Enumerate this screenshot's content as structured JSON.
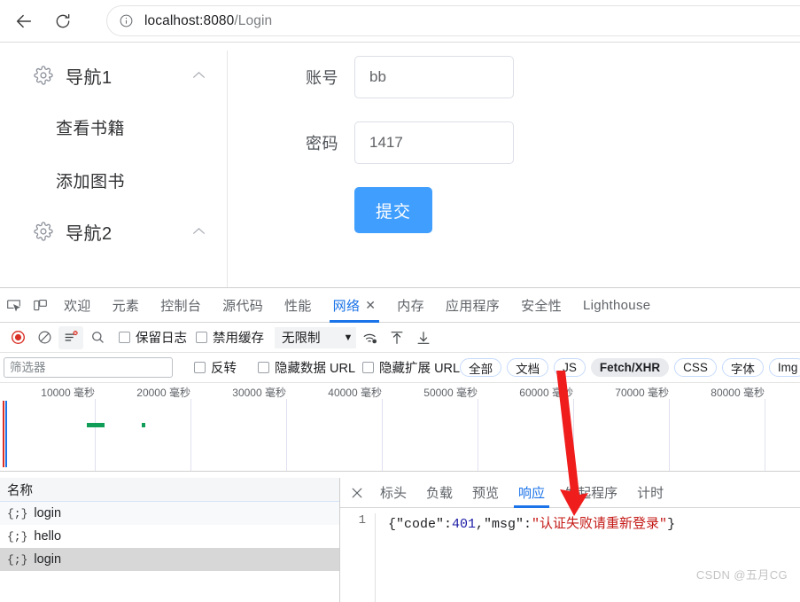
{
  "browser": {
    "back_label": "back-arrow",
    "reload_label": "reload",
    "site_info_label": "site-information",
    "url_host": "localhost:8080",
    "url_path": "/Login"
  },
  "page": {
    "sidebar": {
      "groups": [
        {
          "label": "导航1",
          "icon": "gear-icon",
          "expanded": true,
          "items": [
            "查看书籍",
            "添加图书"
          ]
        },
        {
          "label": "导航2",
          "icon": "gear-icon",
          "expanded": true,
          "items": []
        }
      ]
    },
    "form": {
      "fields": [
        {
          "label": "账号",
          "value": "bb",
          "placeholder": ""
        },
        {
          "label": "密码",
          "value": "1417",
          "placeholder": ""
        }
      ],
      "submit_label": "提交",
      "submit_color": "#409eff"
    }
  },
  "devtools": {
    "tools": [
      {
        "name": "inspect-element-icon"
      },
      {
        "name": "device-toolbar-icon"
      }
    ],
    "tabs": [
      {
        "label": "欢迎",
        "active": false,
        "closable": false
      },
      {
        "label": "元素",
        "active": false,
        "closable": false
      },
      {
        "label": "控制台",
        "active": false,
        "closable": false
      },
      {
        "label": "源代码",
        "active": false,
        "closable": false
      },
      {
        "label": "性能",
        "active": false,
        "closable": false
      },
      {
        "label": "网络",
        "active": true,
        "closable": true
      },
      {
        "label": "内存",
        "active": false,
        "closable": false
      },
      {
        "label": "应用程序",
        "active": false,
        "closable": false
      },
      {
        "label": "安全性",
        "active": false,
        "closable": false
      },
      {
        "label": "Lighthouse",
        "active": false,
        "closable": false
      }
    ],
    "tab_close_glyph": "✕",
    "network_toolbar": {
      "record_label": "record-button",
      "clear_label": "clear-button",
      "filter_label": "filter-button",
      "search_label": "search-button",
      "preserve_log_label": "保留日志",
      "preserve_log_checked": false,
      "disable_cache_label": "禁用缓存",
      "disable_cache_checked": false,
      "throttle_value": "无限制",
      "throttle_caret": "▼",
      "wifi_label": "network-conditions-icon",
      "import_label": "import-har-icon",
      "export_label": "export-har-icon"
    },
    "filter_row": {
      "filter_placeholder": "筛选器",
      "filter_value": "",
      "invert_label": "反转",
      "invert_checked": false,
      "hide_data_urls_label": "隐藏数据 URL",
      "hide_data_urls_checked": false,
      "hide_ext_urls_label": "隐藏扩展 URL",
      "hide_ext_urls_checked": false,
      "type_chips": [
        {
          "label": "全部",
          "selected": false
        },
        {
          "label": "文档",
          "selected": false
        },
        {
          "label": "JS",
          "selected": false
        },
        {
          "label": "Fetch/XHR",
          "selected": true
        },
        {
          "label": "CSS",
          "selected": false
        },
        {
          "label": "字体",
          "selected": false
        },
        {
          "label": "Img",
          "selected": false
        }
      ]
    },
    "overview": {
      "ticks": [
        "10000 毫秒",
        "20000 毫秒",
        "30000 毫秒",
        "40000 毫秒",
        "50000 毫秒",
        "60000 毫秒",
        "70000 毫秒",
        "80000 毫秒"
      ],
      "unit": "毫秒",
      "bars": [
        {
          "left_pct": 11.2,
          "width_pct": 2.0
        },
        {
          "left_pct": 17.8,
          "width_pct": 0.5
        }
      ],
      "markers": [
        {
          "left_pct": 0.35,
          "color": "#d93025"
        },
        {
          "left_pct": 0.75,
          "color": "#1a73e8"
        }
      ]
    },
    "requests": {
      "column_header": "名称",
      "rows": [
        {
          "name": "login",
          "icon": "json-icon",
          "selected": false,
          "alt": true
        },
        {
          "name": "hello",
          "icon": "json-icon",
          "selected": false,
          "alt": false
        },
        {
          "name": "login",
          "icon": "json-icon",
          "selected": true,
          "alt": false
        }
      ]
    },
    "detail": {
      "close_label": "close-detail-panel",
      "close_glyph": "✕",
      "tabs": [
        {
          "label": "标头",
          "active": false
        },
        {
          "label": "负载",
          "active": false
        },
        {
          "label": "预览",
          "active": false
        },
        {
          "label": "响应",
          "active": true
        },
        {
          "label": "发起程序",
          "active": false
        },
        {
          "label": "计时",
          "active": false
        }
      ],
      "response": {
        "line_number": "1",
        "prefix": "{\"code\":",
        "code_value": "401",
        "mid": ",\"msg\":",
        "msg_value": "\"认证失败请重新登录\"",
        "suffix": "}"
      }
    }
  },
  "watermark": "CSDN @五月CG"
}
